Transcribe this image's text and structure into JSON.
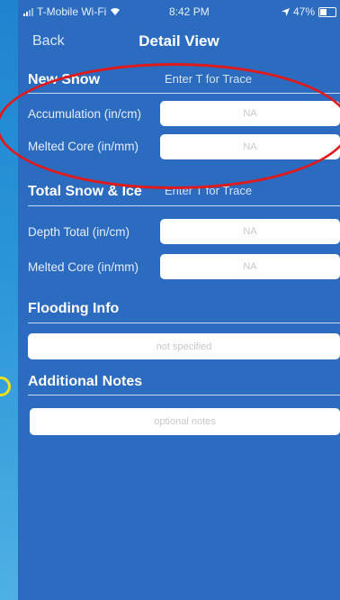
{
  "status": {
    "carrier": "T-Mobile Wi-Fi",
    "time": "8:42 PM",
    "battery": "47%",
    "battery_level": 0.47
  },
  "nav": {
    "back_label": "Back",
    "title": "Detail View"
  },
  "new_snow": {
    "heading": "New Snow",
    "hint": "Enter T for Trace",
    "rows": [
      {
        "label": "Accumulation (in/cm)",
        "placeholder": "NA"
      },
      {
        "label": "Melted Core (in/mm)",
        "placeholder": "NA"
      }
    ]
  },
  "total_snow": {
    "heading": "Total Snow & Ice",
    "hint": "Enter T for Trace",
    "rows": [
      {
        "label": "Depth Total (in/cm)",
        "placeholder": "NA"
      },
      {
        "label": "Melted Core (in/mm)",
        "placeholder": "NA"
      }
    ]
  },
  "flooding": {
    "heading": "Flooding Info",
    "placeholder": "not specified"
  },
  "notes": {
    "heading": "Additional Notes",
    "placeholder": "optional notes"
  },
  "colors": {
    "annotation_ellipse": "#e01a1a",
    "annotation_circle": "#f1e21c",
    "panel": "#2b6bc0"
  }
}
